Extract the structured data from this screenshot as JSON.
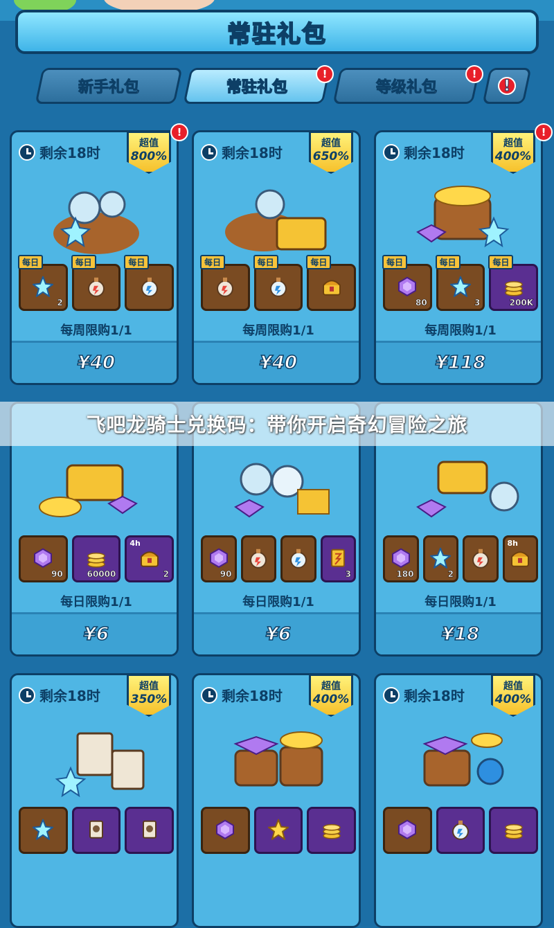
{
  "header": {
    "title": "常驻礼包"
  },
  "tabs": [
    {
      "label": "新手礼包",
      "alert": false
    },
    {
      "label": "常驻礼包",
      "alert": true
    },
    {
      "label": "等级礼包",
      "alert": true
    },
    {
      "label": "",
      "alert": true
    }
  ],
  "alert_mark": "!",
  "overlay_text": "飞吧龙骑士兑换码：带你开启奇幻冒险之旅",
  "daily_tag": "每日",
  "badge_top": "超值",
  "cards": [
    {
      "timer": "剩余18时",
      "badge": "800%",
      "alert": true,
      "limit": "每周限购1/1",
      "price": "¥40",
      "items": [
        {
          "icon": "star-crystal",
          "qty": "2",
          "daily": true
        },
        {
          "icon": "red-potion",
          "qty": "",
          "daily": true
        },
        {
          "icon": "blue-potion",
          "qty": "",
          "daily": true
        }
      ]
    },
    {
      "timer": "剩余18时",
      "badge": "650%",
      "alert": false,
      "limit": "每周限购1/1",
      "price": "¥40",
      "items": [
        {
          "icon": "red-potion",
          "qty": "",
          "daily": true
        },
        {
          "icon": "blue-potion",
          "qty": "",
          "daily": true
        },
        {
          "icon": "gold-chest",
          "qty": "",
          "daily": true
        }
      ]
    },
    {
      "timer": "剩余18时",
      "badge": "400%",
      "alert": true,
      "limit": "每周限购1/1",
      "price": "¥118",
      "items": [
        {
          "icon": "purple-gem",
          "qty": "80",
          "daily": true
        },
        {
          "icon": "star-crystal",
          "qty": "3",
          "daily": true
        },
        {
          "icon": "gold-coins",
          "qty": "200K",
          "daily": true,
          "purple": true
        }
      ]
    },
    {
      "timer": "",
      "badge": "",
      "alert": false,
      "limit": "每日限购1/1",
      "price": "¥6",
      "items": [
        {
          "icon": "purple-gem",
          "qty": "90"
        },
        {
          "icon": "gold-coins",
          "qty": "60000",
          "purple": true
        },
        {
          "icon": "gold-chest",
          "qty": "2",
          "purple": true,
          "ltag": "4h"
        }
      ]
    },
    {
      "timer": "",
      "badge": "",
      "alert": false,
      "limit": "每日限购1/1",
      "price": "¥6",
      "items": [
        {
          "icon": "purple-gem",
          "qty": "90"
        },
        {
          "icon": "red-potion",
          "qty": ""
        },
        {
          "icon": "blue-potion",
          "qty": ""
        },
        {
          "icon": "gold-scroll",
          "qty": "3",
          "purple": true
        }
      ]
    },
    {
      "timer": "",
      "badge": "",
      "alert": false,
      "limit": "每日限购1/1",
      "price": "¥18",
      "items": [
        {
          "icon": "purple-gem",
          "qty": "180"
        },
        {
          "icon": "star-crystal",
          "qty": "2"
        },
        {
          "icon": "red-potion",
          "qty": ""
        },
        {
          "icon": "gold-chest",
          "qty": "",
          "ltag": "8h"
        }
      ]
    },
    {
      "timer": "剩余18时",
      "badge": "350%",
      "alert": false,
      "limit": "",
      "price": "",
      "items": [
        {
          "icon": "star-crystal",
          "qty": ""
        },
        {
          "icon": "scroll",
          "qty": "",
          "purple": true
        },
        {
          "icon": "scroll",
          "qty": "",
          "purple": true
        }
      ]
    },
    {
      "timer": "剩余18时",
      "badge": "400%",
      "alert": false,
      "limit": "",
      "price": "",
      "items": [
        {
          "icon": "purple-gem",
          "qty": ""
        },
        {
          "icon": "gold-star",
          "qty": "",
          "purple": true
        },
        {
          "icon": "gold-coins",
          "qty": "",
          "purple": true
        }
      ]
    },
    {
      "timer": "剩余18时",
      "badge": "400%",
      "alert": false,
      "limit": "",
      "price": "",
      "items": [
        {
          "icon": "purple-gem",
          "qty": ""
        },
        {
          "icon": "blue-potion",
          "qty": "",
          "purple": true
        },
        {
          "icon": "gold-coins",
          "qty": "",
          "purple": true
        }
      ]
    }
  ]
}
